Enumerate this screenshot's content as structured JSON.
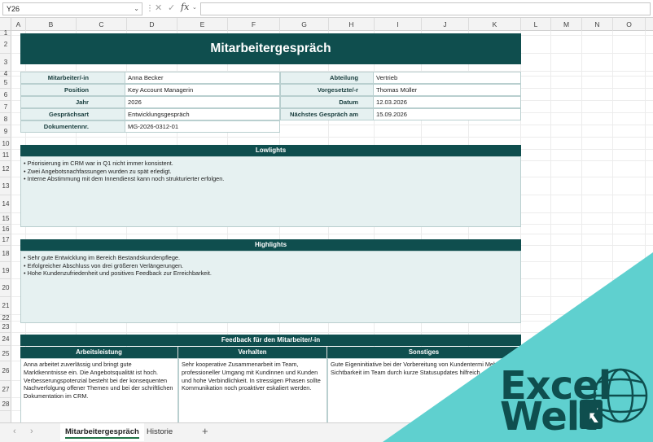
{
  "formula_bar": {
    "cell_ref": "Y26",
    "fx": "fx"
  },
  "columns": [
    "A",
    "B",
    "C",
    "D",
    "E",
    "F",
    "G",
    "H",
    "I",
    "J",
    "K",
    "L",
    "M",
    "N",
    "O"
  ],
  "rows": [
    "1",
    "2",
    "3",
    "4",
    "5",
    "6",
    "7",
    "8",
    "9",
    "10",
    "11",
    "12",
    "13",
    "14",
    "15",
    "16",
    "17",
    "18",
    "19",
    "20",
    "21",
    "22",
    "23",
    "24",
    "25",
    "26",
    "27",
    "28"
  ],
  "sheet": {
    "title": "Mitarbeitergespräch",
    "info_left": [
      {
        "label": "Mitarbeiter/-in",
        "value": "Anna Becker"
      },
      {
        "label": "Position",
        "value": "Key Account Managerin"
      },
      {
        "label": "Jahr",
        "value": "2026"
      },
      {
        "label": "Gesprächsart",
        "value": "Entwicklungsgespräch"
      },
      {
        "label": "Dokumentennr.",
        "value": "MG-2026-0312-01"
      }
    ],
    "info_right": [
      {
        "label": "Abteilung",
        "value": "Vertrieb"
      },
      {
        "label": "Vorgesetzte/-r",
        "value": "Thomas Müller"
      },
      {
        "label": "Datum",
        "value": "12.03.2026"
      },
      {
        "label": "Nächstes Gespräch am",
        "value": "15.09.2026"
      }
    ],
    "lowlights": {
      "title": "Lowlights",
      "items": [
        "• Priorisierung im CRM war in Q1 nicht immer konsistent.",
        "• Zwei Angebotsnachfassungen wurden zu spät erledigt.",
        "• Interne Abstimmung mit dem Innendienst kann noch strukturierter erfolgen."
      ]
    },
    "highlights": {
      "title": "Highlights",
      "items": [
        "• Sehr gute Entwicklung im Bereich Bestandskundenpflege.",
        "• Erfolgreicher Abschluss von drei größeren Verlängerungen.",
        "• Hohe Kundenzufriedenheit und positives Feedback zur Erreichbarkeit."
      ]
    },
    "feedback": {
      "title": "Feedback für den Mitarbeiter/-in",
      "columns": [
        {
          "header": "Arbeitsleistung",
          "text": "Anna arbeitet zuverlässig und bringt gute Marktkenntnisse ein. Die Angebotsqualität ist hoch. Verbesserungspotenzial besteht bei der konsequenten Nachverfolgung offener Themen und bei der schriftlichen Dokumentation im CRM."
        },
        {
          "header": "Verhalten",
          "text": "Sehr kooperative Zusammenarbeit im Team, professioneller Umgang mit Kundinnen und Kunden und hohe Verbindlichkeit. In stressigen Phasen sollte Kommunikation noch proaktiver eskaliert werden."
        },
        {
          "header": "Sonstiges",
          "text": "Gute Eigeninitiative bei der Vorbereitung von Kundentermi Mehr Sichtbarkeit im Team durch kurze Statusupdates hilfreich."
        }
      ]
    }
  },
  "tabs": {
    "active": "Mitarbeitergespräch",
    "other": "Historie",
    "add": "+"
  },
  "brand": {
    "line1": "Excel",
    "line2": "Welt",
    "badge": "X",
    "accent": "#5fd0cf",
    "dark": "#0f4e4e",
    "icon": "globe-icon"
  }
}
